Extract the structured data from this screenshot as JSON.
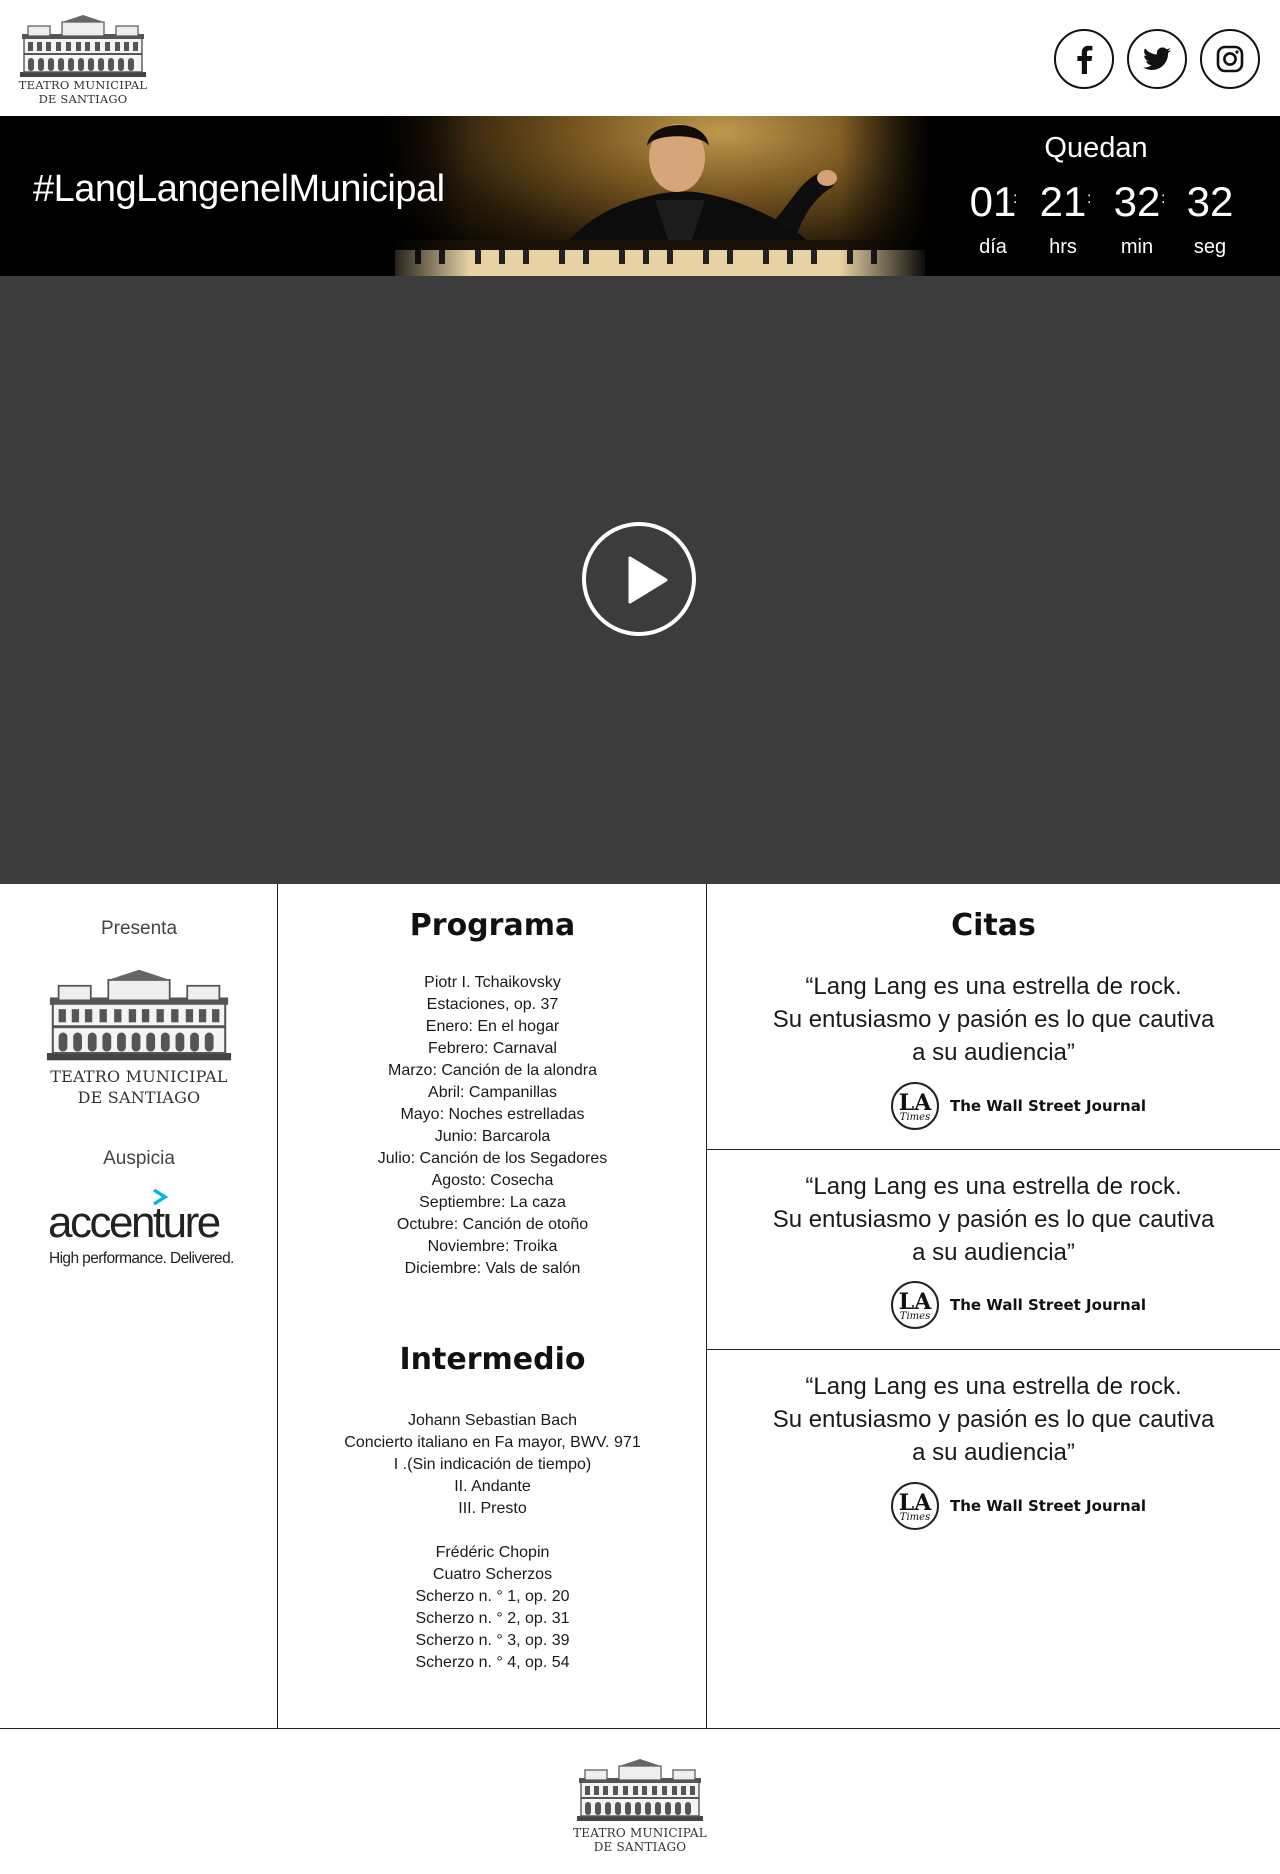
{
  "header": {
    "logo": {
      "line1": "TEATRO MUNICIPAL",
      "line2": "DE SANTIAGO"
    },
    "social": [
      {
        "name": "facebook",
        "icon": "facebook-icon"
      },
      {
        "name": "twitter",
        "icon": "twitter-icon"
      },
      {
        "name": "instagram",
        "icon": "instagram-icon"
      }
    ]
  },
  "hero": {
    "hashtag": "#LangLangenelMunicipal",
    "countdown": {
      "label": "Quedan",
      "separator": ":",
      "days": "01",
      "hours": "21",
      "minutes": "32",
      "seconds": "32",
      "days_unit": "día",
      "hours_unit": "hrs",
      "minutes_unit": "min",
      "seconds_unit": "seg"
    }
  },
  "video": {
    "background": "#3c3c3c",
    "play_icon": "play-icon"
  },
  "presenta": {
    "label": "Presenta",
    "logo_line1": "TEATRO MUNICIPAL",
    "logo_line2": "DE SANTIAGO",
    "auspicia_label": "Auspicia",
    "sponsor_name": "accenture",
    "sponsor_tagline": "High performance. Delivered.",
    "sponsor_accent": "#00b4e6"
  },
  "programa": {
    "title": "Programa",
    "items": [
      "Piotr I. Tchaikovsky",
      "Estaciones, op. 37",
      "Enero: En el hogar",
      "Febrero: Carnaval",
      "Marzo: Canción de la alondra",
      "Abril: Campanillas",
      "Mayo: Noches estrelladas",
      "Junio: Barcarola",
      "Julio: Canción de los Segadores",
      "Agosto: Cosecha",
      "Septiembre: La caza",
      "Octubre: Canción de otoño",
      "Noviembre: Troika",
      "Diciembre: Vals de salón"
    ]
  },
  "intermedio": {
    "title": "Intermedio",
    "items": [
      "Johann Sebastian Bach",
      "Concierto italiano en Fa mayor, BWV. 971",
      "I .(Sin indicación de tiempo)",
      "II. Andante",
      "III. Presto",
      "",
      "Frédéric Chopin",
      "Cuatro Scherzos",
      "Scherzo n. ° 1, op. 20",
      "Scherzo n. ° 2, op. 31",
      "Scherzo n. ° 3, op. 39",
      "Scherzo n. ° 4, op. 54"
    ]
  },
  "citas": {
    "title": "Citas",
    "quotes": [
      {
        "line1": "“Lang Lang es una estrella de rock.",
        "line2": "Su entusiasmo y pasión es lo que cautiva",
        "line3": "a su audiencia”",
        "badge_main": "LA",
        "badge_sub": "Times",
        "source": "The Wall Street Journal"
      },
      {
        "line1": "“Lang Lang es una estrella de rock.",
        "line2": "Su entusiasmo y pasión es lo que cautiva",
        "line3": "a su audiencia”",
        "badge_main": "LA",
        "badge_sub": "Times",
        "source": "The Wall Street Journal"
      },
      {
        "line1": "“Lang Lang es una estrella de rock.",
        "line2": "Su entusiasmo y pasión es lo que cautiva",
        "line3": "a su audiencia”",
        "badge_main": "LA",
        "badge_sub": "Times",
        "source": "The Wall Street Journal"
      }
    ]
  },
  "footer": {
    "logo_line1": "TEATRO MUNICIPAL",
    "logo_line2": "DE SANTIAGO"
  }
}
